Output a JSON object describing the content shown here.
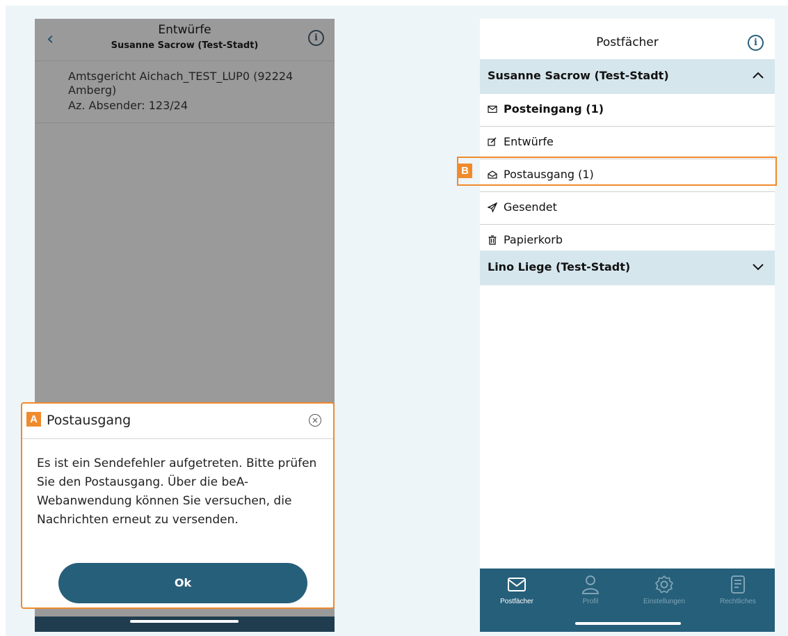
{
  "left": {
    "title": "Entwürfe",
    "subtitle": "Susanne Sacrow (Test-Stadt)",
    "message": {
      "recipient": "Amtsgericht Aichach_TEST_LUP0 (92224 Amberg)",
      "reference": "Az. Absender: 123/24"
    },
    "dialog": {
      "badge": "A",
      "title": "Postausgang",
      "body": "Es ist ein Sendefehler aufgetreten. Bitte prüfen Sie den Postausgang. Über die beA-Webanwendung können Sie versuchen, die Nachrichten erneut zu versenden.",
      "ok_label": "Ok"
    }
  },
  "right": {
    "title": "Postfächer",
    "groups": [
      {
        "label": "Susanne Sacrow (Test-Stadt)",
        "expanded": true,
        "items": [
          {
            "label": "Posteingang (1)",
            "icon": "inbox-icon",
            "bold": true
          },
          {
            "label": "Entwürfe",
            "icon": "edit-icon",
            "bold": false
          },
          {
            "label": "Postausgang (1)",
            "icon": "outbox-icon",
            "bold": false
          },
          {
            "label": "Gesendet",
            "icon": "send-icon",
            "bold": false
          },
          {
            "label": "Papierkorb",
            "icon": "trash-icon",
            "bold": false
          }
        ]
      },
      {
        "label": "Lino Liege (Test-Stadt)",
        "expanded": false
      }
    ],
    "highlight_badge": "B",
    "tabs": [
      {
        "label": "Postfächer",
        "icon": "mail-icon",
        "active": true
      },
      {
        "label": "Profil",
        "icon": "profile-icon",
        "active": false
      },
      {
        "label": "Einstellungen",
        "icon": "settings-icon",
        "active": false
      },
      {
        "label": "Rechtliches",
        "icon": "document-icon",
        "active": false
      }
    ]
  },
  "colors": {
    "accent": "#265f7a",
    "highlight": "#f08a2c",
    "group_bg": "#d6e6ed",
    "overlay": "#9a9a9a"
  }
}
